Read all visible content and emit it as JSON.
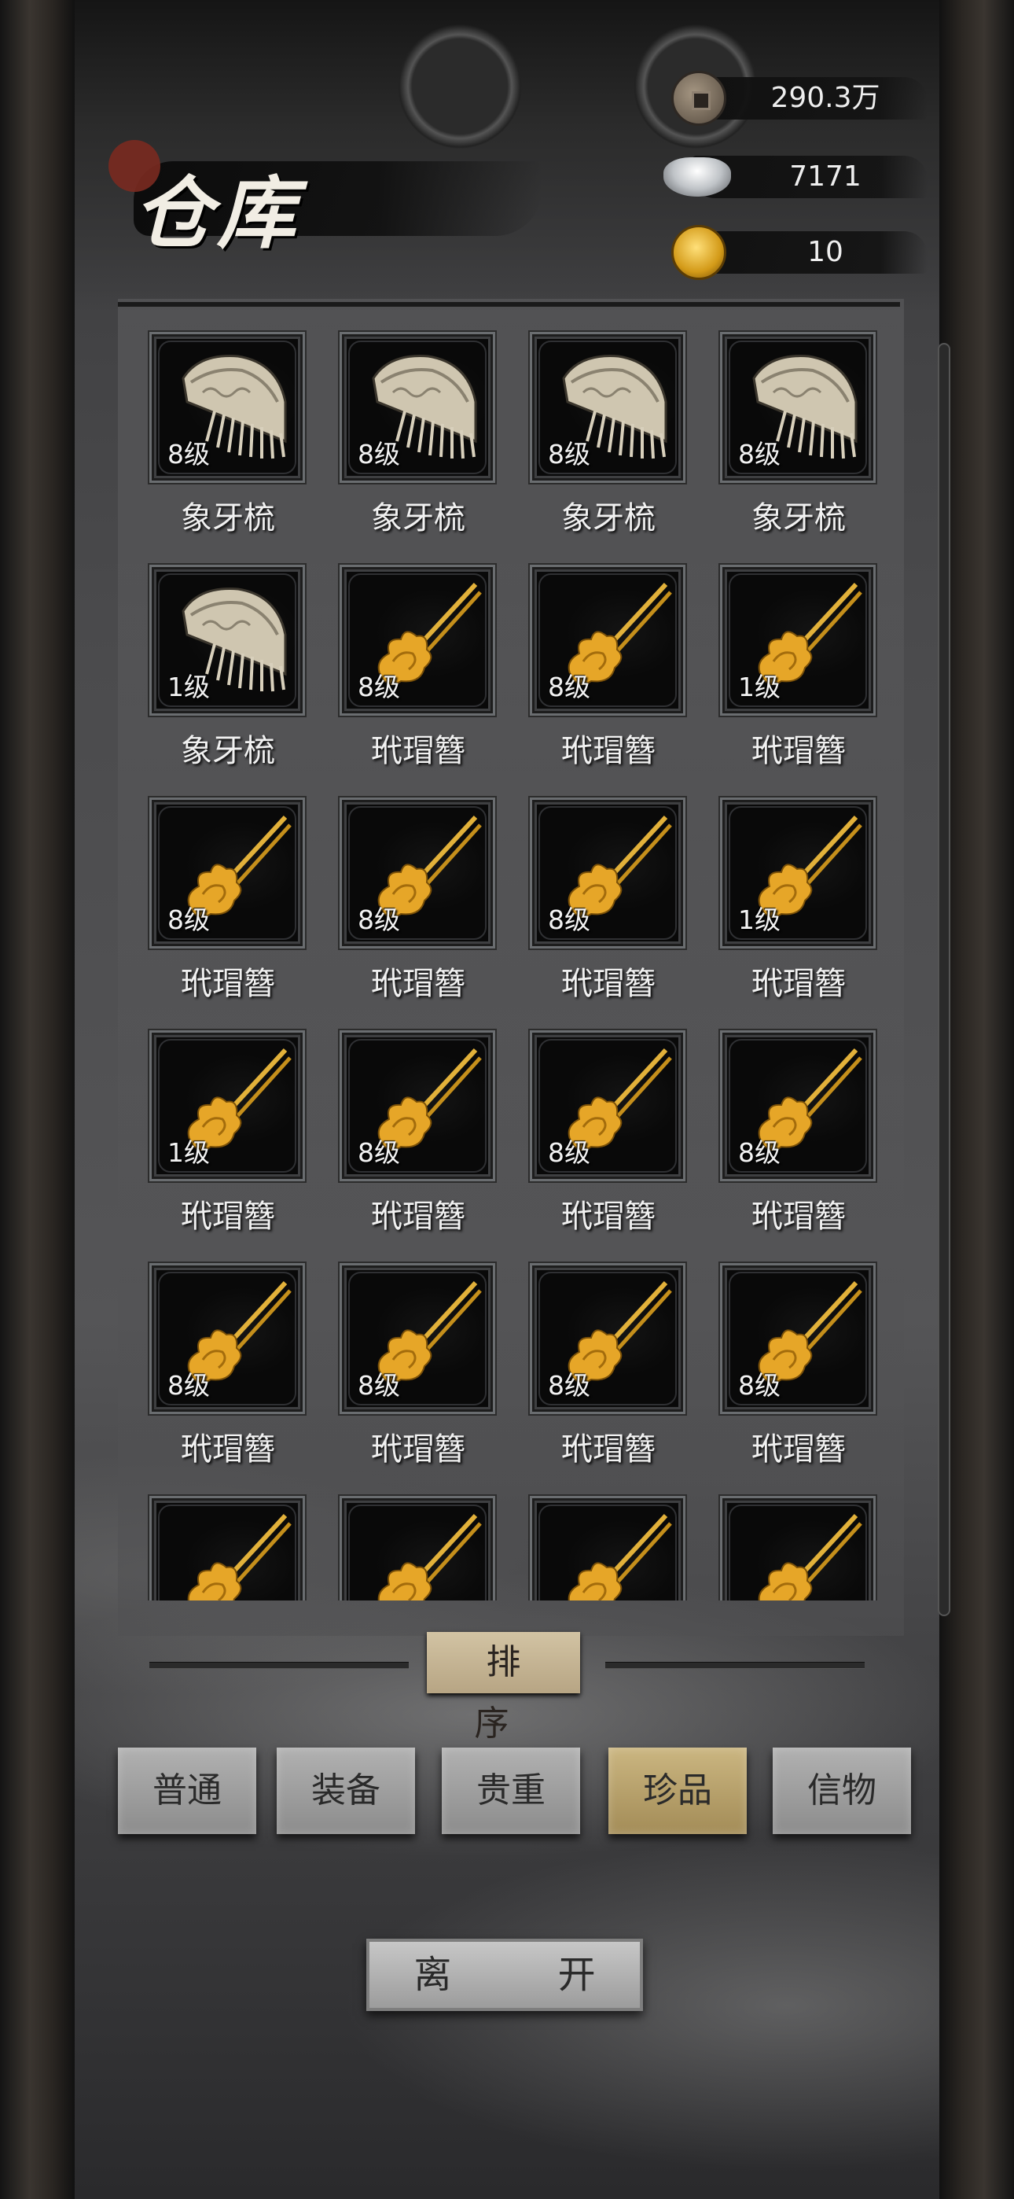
{
  "header": {
    "title": "仓库",
    "currencies": [
      {
        "icon": "copper-coin-icon",
        "value": "290.3万"
      },
      {
        "icon": "silver-ingot-icon",
        "value": "7171"
      },
      {
        "icon": "gold-coin-icon",
        "value": "10"
      }
    ]
  },
  "items": [
    {
      "name": "象牙梳",
      "level": "8级",
      "icon": "ivory-comb-icon"
    },
    {
      "name": "象牙梳",
      "level": "8级",
      "icon": "ivory-comb-icon"
    },
    {
      "name": "象牙梳",
      "level": "8级",
      "icon": "ivory-comb-icon"
    },
    {
      "name": "象牙梳",
      "level": "8级",
      "icon": "ivory-comb-icon"
    },
    {
      "name": "象牙梳",
      "level": "1级",
      "icon": "ivory-comb-icon"
    },
    {
      "name": "玳瑁簪",
      "level": "8级",
      "icon": "hairpin-icon"
    },
    {
      "name": "玳瑁簪",
      "level": "8级",
      "icon": "hairpin-icon"
    },
    {
      "name": "玳瑁簪",
      "level": "1级",
      "icon": "hairpin-icon"
    },
    {
      "name": "玳瑁簪",
      "level": "8级",
      "icon": "hairpin-icon"
    },
    {
      "name": "玳瑁簪",
      "level": "8级",
      "icon": "hairpin-icon"
    },
    {
      "name": "玳瑁簪",
      "level": "8级",
      "icon": "hairpin-icon"
    },
    {
      "name": "玳瑁簪",
      "level": "1级",
      "icon": "hairpin-icon"
    },
    {
      "name": "玳瑁簪",
      "level": "1级",
      "icon": "hairpin-icon"
    },
    {
      "name": "玳瑁簪",
      "level": "8级",
      "icon": "hairpin-icon"
    },
    {
      "name": "玳瑁簪",
      "level": "8级",
      "icon": "hairpin-icon"
    },
    {
      "name": "玳瑁簪",
      "level": "8级",
      "icon": "hairpin-icon"
    },
    {
      "name": "玳瑁簪",
      "level": "8级",
      "icon": "hairpin-icon"
    },
    {
      "name": "玳瑁簪",
      "level": "8级",
      "icon": "hairpin-icon"
    },
    {
      "name": "玳瑁簪",
      "level": "8级",
      "icon": "hairpin-icon"
    },
    {
      "name": "玳瑁簪",
      "level": "8级",
      "icon": "hairpin-icon"
    },
    {
      "name": "",
      "level": "",
      "icon": "hairpin-icon"
    },
    {
      "name": "",
      "level": "",
      "icon": "hairpin-icon"
    },
    {
      "name": "",
      "level": "",
      "icon": "hairpin-icon"
    },
    {
      "name": "",
      "level": "",
      "icon": "hairpin-icon"
    }
  ],
  "sort": {
    "label": "排 序"
  },
  "tabs": [
    {
      "label": "普通",
      "active": false
    },
    {
      "label": "装备",
      "active": false
    },
    {
      "label": "贵重",
      "active": false
    },
    {
      "label": "珍品",
      "active": true
    },
    {
      "label": "信物",
      "active": false
    }
  ],
  "leave": {
    "label": "离 开"
  }
}
